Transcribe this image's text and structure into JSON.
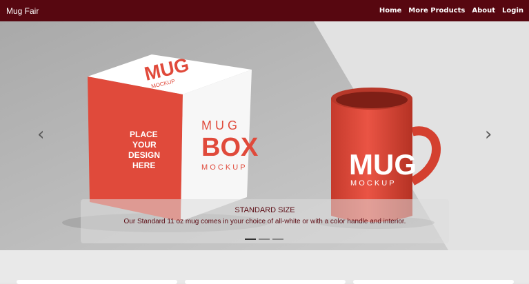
{
  "navbar": {
    "brand": "Mug Fair",
    "links": [
      "Home",
      "More Products",
      "About",
      "Login"
    ]
  },
  "carousel": {
    "prev_icon": "chevron-left-icon",
    "next_icon": "chevron-right-icon",
    "slide": {
      "box_logo": "MUG",
      "box_logo_sub": "MOCKUP",
      "box_side_text": [
        "PLACE",
        "YOUR",
        "DESIGN",
        "HERE"
      ],
      "box_front_title_1": "M U G",
      "box_front_title_2": "BOX",
      "box_front_title_3": "M O C K U P",
      "mug_title": "MUG",
      "mug_sub": "M O C K U P",
      "caption_title": "STANDARD SIZE",
      "caption_text": "Our Standard 11 oz mug comes in your choice of all-white or with a color handle and interior."
    },
    "indicators": [
      true,
      false,
      false
    ]
  },
  "colors": {
    "navbar": "#570710",
    "accent_red": "#e04a3b",
    "caption_text": "#5a0a12"
  }
}
